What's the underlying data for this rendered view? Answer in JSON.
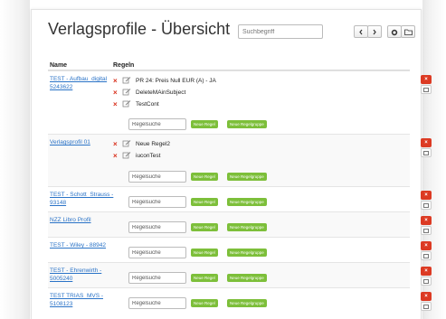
{
  "page": {
    "title": "Verlagsprofile - Übersicht",
    "search_placeholder": "Suchbegriff"
  },
  "toolbar": {
    "prev_icon": "chevron-left-icon",
    "next_icon": "chevron-right-icon",
    "settings_icon": "gear-icon",
    "folder_icon": "folder-icon"
  },
  "table": {
    "col_name": "Name",
    "col_rules": "Regeln",
    "rule_search_value": "Regelsuche",
    "new_rule_label": "Neue Regel",
    "new_group_label": "Neue Regelgruppe",
    "delete_label": "×",
    "rows": [
      {
        "name": "TEST - Aufbau_digital 5243622",
        "rules": [
          "PR 24: Preis Null EUR (A) - JA",
          "DeleteMAinSubject",
          "TestCont"
        ]
      },
      {
        "name": "Verlagsprofil 01",
        "rules": [
          "Neue Regel2",
          "iuconTest"
        ]
      },
      {
        "name": "TEST - Schott_Strauss - 93148",
        "rules": []
      },
      {
        "name": "NZZ Libro Profil",
        "rules": []
      },
      {
        "name": "TEST - Wiley - 88942",
        "rules": []
      },
      {
        "name": "TEST - Ehrenwirth - 5005240",
        "rules": []
      },
      {
        "name": "TEST TRIAS_MVS - 5108123",
        "rules": []
      }
    ]
  },
  "colors": {
    "link": "#2a73c7",
    "delete": "#dc3a23",
    "green": "#7dbf3a"
  }
}
